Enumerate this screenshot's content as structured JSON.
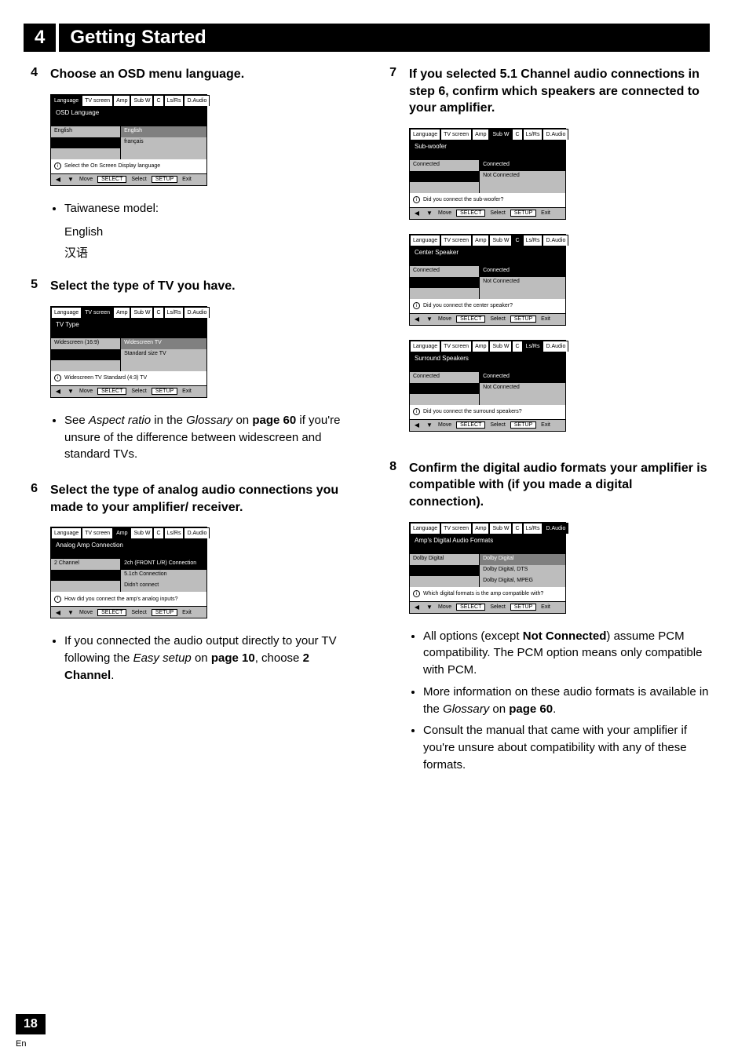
{
  "chapter": {
    "number": "4",
    "title": "Getting Started"
  },
  "page_number": "18",
  "lang_code": "En",
  "left": {
    "step4": {
      "num": "4",
      "heading": "Choose an OSD menu language.",
      "osd": {
        "tabs": [
          "Language",
          "TV screen",
          "Amp",
          "Sub W",
          "C",
          "Ls/Rs",
          "D.Audio"
        ],
        "active_tab": 0,
        "body_title": "OSD Language",
        "rows": [
          {
            "left": "English",
            "right": "English",
            "left_dark": false,
            "right_style": "graydark"
          },
          {
            "left": "",
            "right": "français",
            "left_dark": true,
            "right_style": "light"
          },
          {
            "left": "",
            "right": "",
            "left_dark": false,
            "right_style": "light"
          }
        ],
        "info": "Select the On Screen Display language",
        "nav": {
          "move": "Move",
          "select": "SELECT",
          "exit": "SETUP",
          "exit_label": "Exit",
          "select_label": "Select"
        }
      },
      "bullet": "Taiwanese model:",
      "lines": [
        "English",
        "汉语"
      ]
    },
    "step5": {
      "num": "5",
      "heading": "Select the type of TV you have.",
      "osd": {
        "tabs": [
          "Language",
          "TV screen",
          "Amp",
          "Sub W",
          "C",
          "Ls/Rs",
          "D.Audio"
        ],
        "active_tab": 1,
        "body_title": "TV Type",
        "rows": [
          {
            "left": "Widescreen (16:9)",
            "right": "Widescreen TV",
            "left_dark": false,
            "right_style": "graydark"
          },
          {
            "left": "",
            "right": "Standard size TV",
            "left_dark": true,
            "right_style": "light"
          },
          {
            "left": "",
            "right": "",
            "left_dark": false,
            "right_style": "light"
          }
        ],
        "info": "Widescreen TV Standard (4:3) TV",
        "nav": {
          "move": "Move",
          "select": "SELECT",
          "exit": "SETUP",
          "exit_label": "Exit",
          "select_label": "Select"
        }
      },
      "bullets": [
        {
          "pre": "See ",
          "italic": "Aspect ratio",
          "mid": " in the ",
          "italic2": "Glossary",
          "mid2": " on ",
          "bold": "page 60",
          "post": " if you're unsure of the difference between widescreen and standard TVs."
        }
      ]
    },
    "step6": {
      "num": "6",
      "heading": "Select the type of analog audio connections you made to your amplifier/ receiver.",
      "osd": {
        "tabs": [
          "Language",
          "TV screen",
          "Amp",
          "Sub W",
          "C",
          "Ls/Rs",
          "D.Audio"
        ],
        "active_tab": 2,
        "body_title": "Analog Amp Connection",
        "rows": [
          {
            "left": "2 Channel",
            "right": "2ch (FRONT L/R) Connection",
            "left_dark": false,
            "right_style": "black"
          },
          {
            "left": "",
            "right": "5.1ch Connection",
            "left_dark": true,
            "right_style": "light"
          },
          {
            "left": "",
            "right": "Didn't connect",
            "left_dark": false,
            "right_style": "light"
          }
        ],
        "info": "How did you connect the amp's analog inputs?",
        "nav": {
          "move": "Move",
          "select": "SELECT",
          "exit": "SETUP",
          "exit_label": "Exit",
          "select_label": "Select"
        }
      },
      "bullets": [
        {
          "pre": "If you connected the audio output directly to your TV following the ",
          "italic": "Easy setup",
          "mid": " on ",
          "bold": "page 10",
          "post": ", choose ",
          "bold2": "2 Channel",
          "post2": "."
        }
      ]
    }
  },
  "right": {
    "step7": {
      "num": "7",
      "heading": "If you selected 5.1 Channel audio connections in step 6, confirm which speakers are connected to your amplifier.",
      "osd_list": [
        {
          "tabs": [
            "Language",
            "TV screen",
            "Amp",
            "Sub W",
            "C",
            "Ls/Rs",
            "D.Audio"
          ],
          "active_tab": 3,
          "body_title": "Sub-woofer",
          "rows": [
            {
              "left": "Connected",
              "right": "Connected",
              "left_dark": false,
              "right_style": "black"
            },
            {
              "left": "",
              "right": "Not Connected",
              "left_dark": true,
              "right_style": "light"
            },
            {
              "left": "",
              "right": "",
              "left_dark": false,
              "right_style": "light"
            }
          ],
          "info": "Did you connect the sub-woofer?",
          "nav": {
            "move": "Move",
            "select": "SELECT",
            "exit": "SETUP",
            "exit_label": "Exit",
            "select_label": "Select"
          }
        },
        {
          "tabs": [
            "Language",
            "TV screen",
            "Amp",
            "Sub W",
            "C",
            "Ls/Rs",
            "D.Audio"
          ],
          "active_tab": 4,
          "body_title": "Center Speaker",
          "rows": [
            {
              "left": "Connected",
              "right": "Connected",
              "left_dark": false,
              "right_style": "black"
            },
            {
              "left": "",
              "right": "Not Connected",
              "left_dark": true,
              "right_style": "light"
            },
            {
              "left": "",
              "right": "",
              "left_dark": false,
              "right_style": "light"
            }
          ],
          "info": "Did you connect the center speaker?",
          "nav": {
            "move": "Move",
            "select": "SELECT",
            "exit": "SETUP",
            "exit_label": "Exit",
            "select_label": "Select"
          }
        },
        {
          "tabs": [
            "Language",
            "TV screen",
            "Amp",
            "Sub W",
            "C",
            "Ls/Rs",
            "D.Audio"
          ],
          "active_tab": 5,
          "body_title": "Surround Speakers",
          "rows": [
            {
              "left": "Connected",
              "right": "Connected",
              "left_dark": false,
              "right_style": "black"
            },
            {
              "left": "",
              "right": "Not Connected",
              "left_dark": true,
              "right_style": "light"
            },
            {
              "left": "",
              "right": "",
              "left_dark": false,
              "right_style": "light"
            }
          ],
          "info": "Did you connect the surround speakers?",
          "nav": {
            "move": "Move",
            "select": "SELECT",
            "exit": "SETUP",
            "exit_label": "Exit",
            "select_label": "Select"
          }
        }
      ]
    },
    "step8": {
      "num": "8",
      "heading": "Confirm the digital audio formats your amplifier is compatible with (if you made a digital connection).",
      "osd": {
        "tabs": [
          "Language",
          "TV screen",
          "Amp",
          "Sub W",
          "C",
          "Ls/Rs",
          "D.Audio"
        ],
        "active_tab": 6,
        "body_title": "Amp's Digital Audio Formats",
        "rows": [
          {
            "left": "Dolby Digital",
            "right": "Dolby Digital",
            "left_dark": false,
            "right_style": "graydark"
          },
          {
            "left": "",
            "right": "Dolby Digital, DTS",
            "left_dark": true,
            "right_style": "light"
          },
          {
            "left": "",
            "right": "Dolby Digital, MPEG",
            "left_dark": false,
            "right_style": "light"
          }
        ],
        "info": "Which digital formats is the amp compatible with?",
        "nav": {
          "move": "Move",
          "select": "SELECT",
          "exit": "SETUP",
          "exit_label": "Exit",
          "select_label": "Select"
        }
      },
      "bullets": [
        {
          "pre": "All options (except ",
          "bold": "Not Connected",
          "post": ") assume PCM compatibility. The PCM option means only compatible with PCM."
        },
        {
          "pre": "More information on these audio formats is available in the ",
          "italic": "Glossary",
          "mid": " on ",
          "bold2": "page 60",
          "post2": "."
        },
        {
          "pre": "Consult the manual that came with your amplifier if you're unsure about compatibility with any of these formats."
        }
      ]
    }
  }
}
